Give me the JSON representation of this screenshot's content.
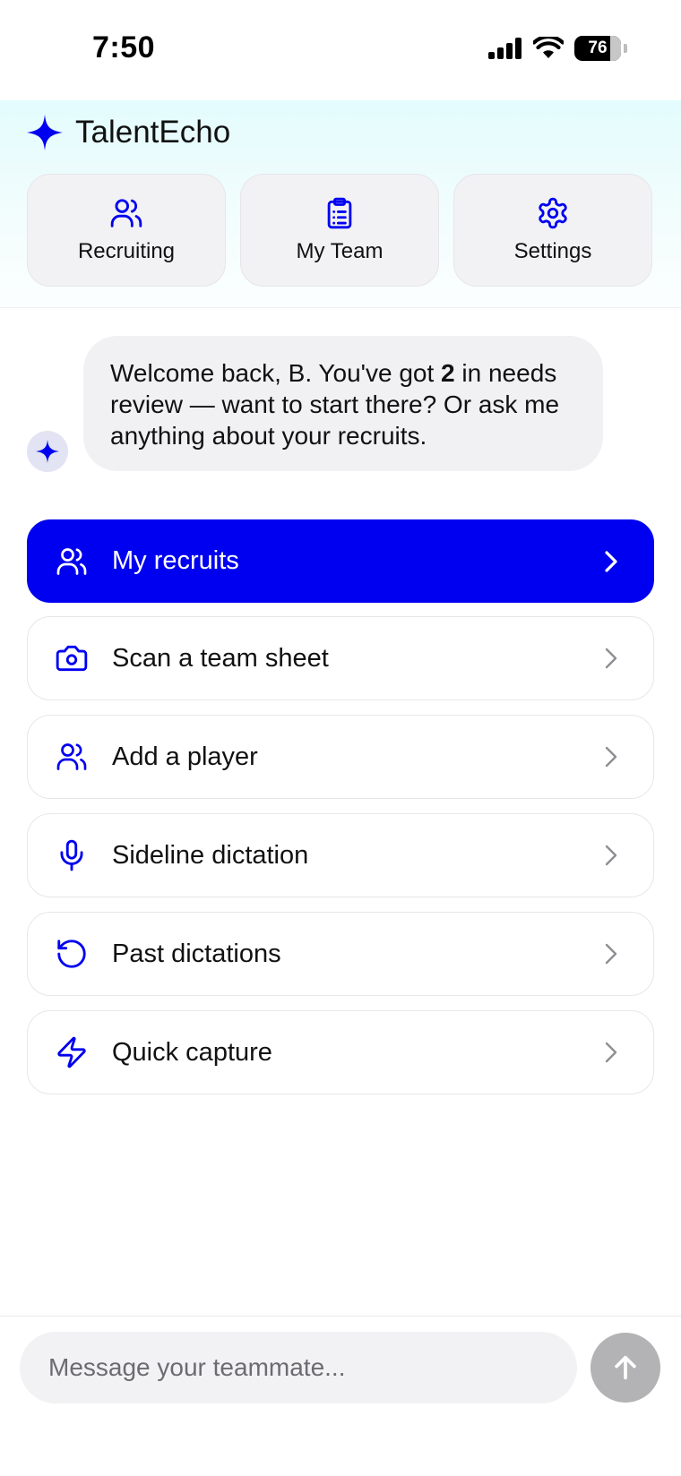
{
  "status_bar": {
    "time": "7:50",
    "battery": "76",
    "icons": [
      "signal-icon",
      "wifi-icon",
      "battery-icon"
    ]
  },
  "header": {
    "brand": "TalentEcho",
    "brand_icon": "sparkle-icon",
    "tabs": [
      {
        "label": "Recruiting",
        "icon": "users-icon"
      },
      {
        "label": "My Team",
        "icon": "clipboard-icon"
      },
      {
        "label": "Settings",
        "icon": "gear-icon"
      }
    ]
  },
  "chat": {
    "message_before": "Welcome back, B. You've got ",
    "message_count": "2",
    "message_after": " in needs review — want to start there? Or ask me anything about your recruits."
  },
  "menu": {
    "items": [
      {
        "label": "My recruits",
        "icon": "users-icon",
        "primary": true
      },
      {
        "label": "Scan a team sheet",
        "icon": "camera-icon"
      },
      {
        "label": "Add a player",
        "icon": "users-icon"
      },
      {
        "label": "Sideline dictation",
        "icon": "microphone-icon"
      },
      {
        "label": "Past dictations",
        "icon": "history-icon"
      },
      {
        "label": "Quick capture",
        "icon": "lightning-icon"
      }
    ]
  },
  "composer": {
    "placeholder": "Message your teammate...",
    "value": ""
  },
  "colors": {
    "accent": "#0000F0",
    "header_gradient_top": "#E3FCFD",
    "send_button_disabled": "#B3B3B5"
  }
}
